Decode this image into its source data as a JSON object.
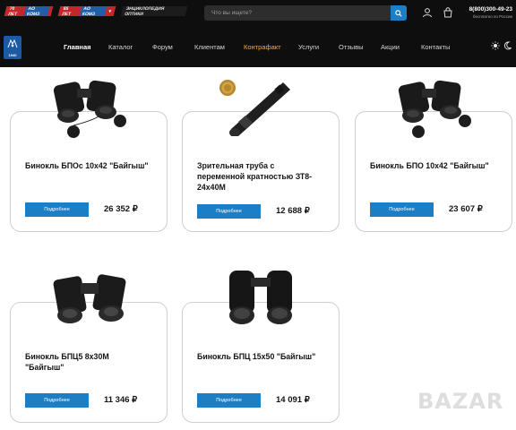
{
  "header": {
    "badges": [
      {
        "left": "70 ЛЕТ",
        "right": "АО КОМЗ"
      },
      {
        "left": "85 ЛЕТ",
        "right": "АО КОМЗ"
      },
      {
        "label": "ЭНЦИКЛОПЕДИЯ ОПТИКИ"
      }
    ],
    "search_placeholder": "Что вы ищете?",
    "phone": "8(800)300-49-23",
    "phone_note": "бесплатно по России",
    "logo_year": "1940"
  },
  "nav": {
    "items": [
      "Главная",
      "Каталог",
      "Форум",
      "Клиентам",
      "Контрафакт",
      "Услуги",
      "Отзывы",
      "Акции",
      "Контакты"
    ],
    "active": "Главная",
    "highlight": "Контрафакт"
  },
  "products": [
    {
      "name": "Бинокль БПОс 10х42 \"Байгыш\"",
      "price": "26 352 ₽",
      "button": "Подробнее"
    },
    {
      "name": "Зрительная труба с переменной кратностью ЗТ8-24х40М",
      "price": "12 688 ₽",
      "button": "Подробнее"
    },
    {
      "name": "Бинокль БПО 10х42 \"Байгыш\"",
      "price": "23 607 ₽",
      "button": "Подробнее"
    },
    {
      "name": "Бинокль БПЦ5 8х30М \"Байгыш\"",
      "price": "11 346 ₽",
      "button": "Подробнее"
    },
    {
      "name": "Бинокль БПЦ 15х50 \"Байгыш\"",
      "price": "14 091 ₽",
      "button": "Подробнее"
    }
  ],
  "watermark": "BAZAR",
  "colors": {
    "accent": "#1c7fc6",
    "header_bg": "#0e0e0e",
    "highlight": "#f2b326",
    "badge_red": "#c3272c",
    "badge_blue": "#1f5fa8"
  }
}
